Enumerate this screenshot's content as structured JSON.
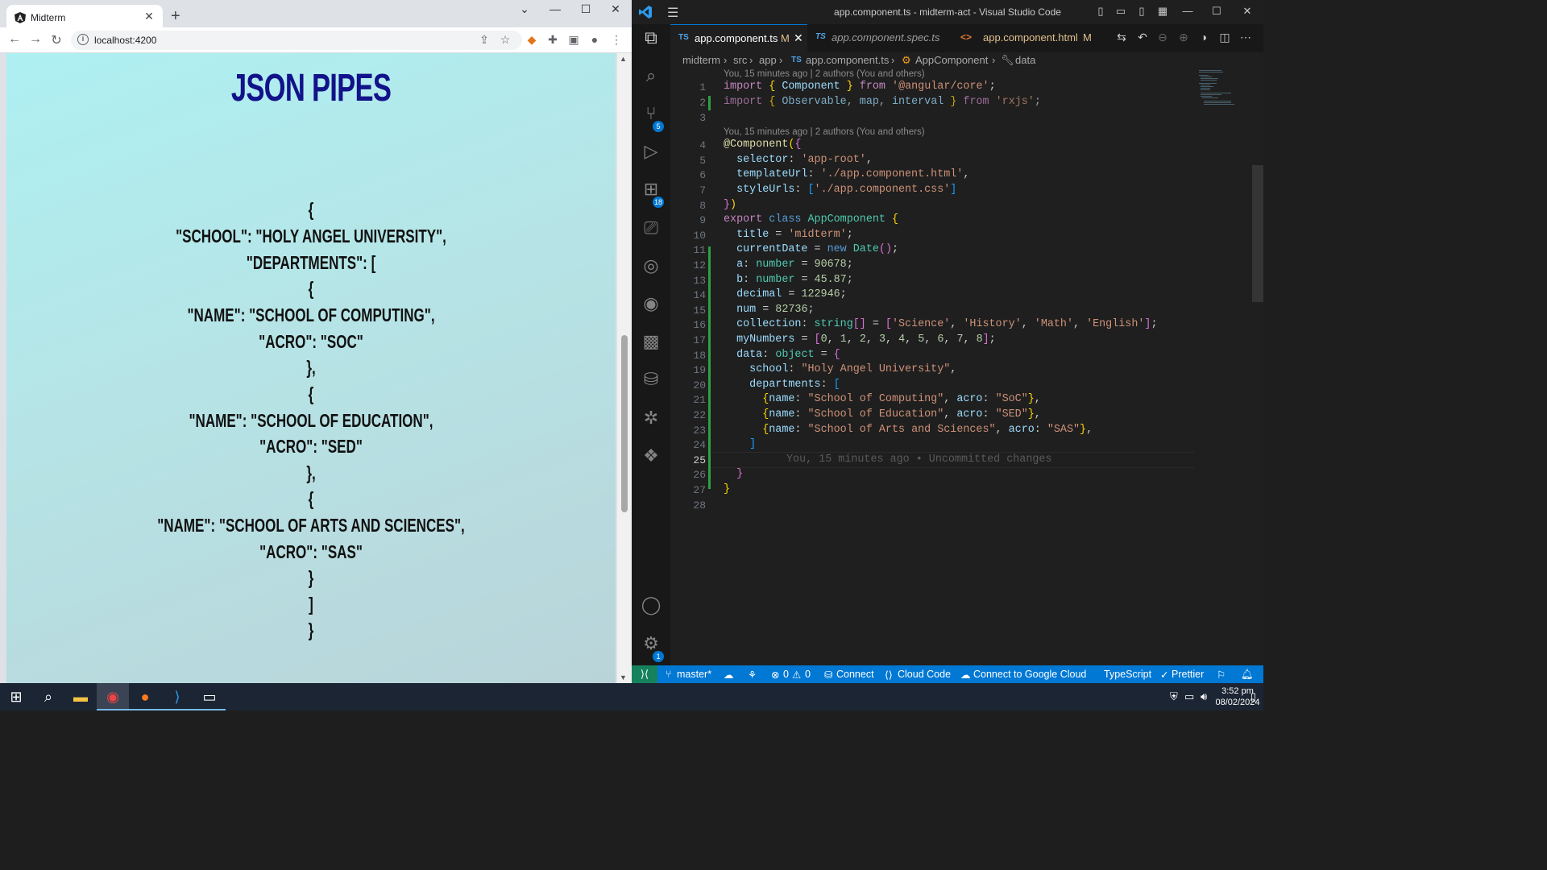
{
  "browser": {
    "tab_title": "Midterm",
    "url": "localhost:4200",
    "page_title": "JSON Pipes",
    "json_lines": [
      "{",
      "\"school\": \"Holy Angel University\",",
      "\"departments\": [",
      "{",
      "\"name\": \"School of Computing\",",
      "\"acro\": \"SoC\"",
      "},",
      "{",
      "\"name\": \"School of Education\",",
      "\"acro\": \"SED\"",
      "},",
      "{",
      "\"name\": \"School of Arts and Sciences\",",
      "\"acro\": \"SAS\"",
      "}",
      "]",
      "}"
    ]
  },
  "vscode": {
    "window_title": "app.component.ts - midterm-act - Visual Studio Code",
    "tabs": [
      {
        "lang": "TS",
        "name": "app.component.ts",
        "mod": "M"
      },
      {
        "lang": "TS",
        "name": "app.component.spec.ts",
        "mod": ""
      },
      {
        "lang": "<>",
        "name": "app.component.html",
        "mod": "M"
      }
    ],
    "breadcrumb": [
      "midterm",
      "src",
      "app",
      "app.component.ts",
      "AppComponent",
      "data"
    ],
    "codelens_1": "You, 15 minutes ago | 2 authors (You and others)",
    "codelens_2": "You, 15 minutes ago | 2 authors (You and others)",
    "ghost_text": "You, 15 minutes ago • Uncommitted changes",
    "badges": {
      "scm": "5",
      "extensions": "18",
      "settings": "1"
    },
    "line_numbers": [
      "1",
      "2",
      "3",
      "4",
      "5",
      "6",
      "7",
      "8",
      "9",
      "10",
      "11",
      "12",
      "13",
      "14",
      "15",
      "16",
      "17",
      "18",
      "19",
      "20",
      "21",
      "22",
      "23",
      "24",
      "25",
      "26",
      "27",
      "28"
    ],
    "status": {
      "branch": "master*",
      "errors": "0",
      "warnings": "0",
      "connect": "Connect",
      "cloud_code": "Cloud Code",
      "google_cloud": "Connect to Google Cloud",
      "language": "TypeScript",
      "prettier": "Prettier"
    }
  },
  "taskbar": {
    "time": "3:52 pm",
    "date": "08/02/2024"
  }
}
